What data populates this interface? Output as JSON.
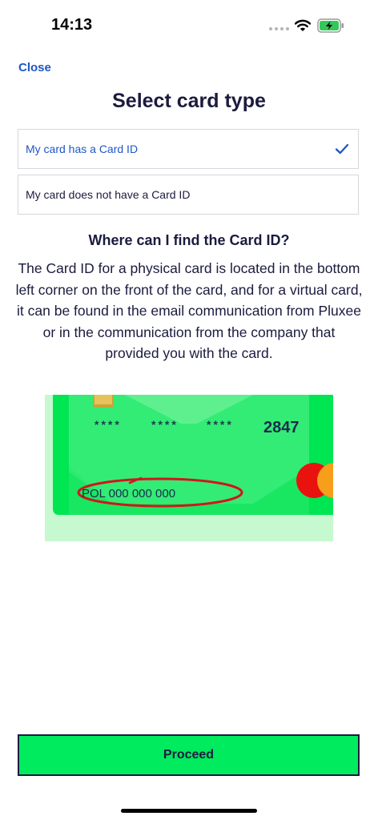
{
  "status_bar": {
    "time": "14:13"
  },
  "nav": {
    "close_label": "Close"
  },
  "title": "Select card type",
  "options": [
    {
      "label": "My card has a Card ID",
      "selected": true
    },
    {
      "label": "My card does not have a Card ID",
      "selected": false
    }
  ],
  "help": {
    "heading": "Where can I find the Card ID?",
    "text": "The Card ID for a physical card is located in the bottom left corner on the front of the card, and for a virtual card, it can be found in the email communication from Pluxee or in the communication from the company that provided you with the card."
  },
  "card": {
    "masked_groups": [
      "****",
      "****",
      "****"
    ],
    "last_digits": "2847",
    "card_id": "POL 000 000 000"
  },
  "proceed_label": "Proceed",
  "colors": {
    "accent": "#1f56c6",
    "brand_green": "#00eb5e",
    "text_dark": "#1b1b3f",
    "highlight_red": "#d0161c"
  }
}
